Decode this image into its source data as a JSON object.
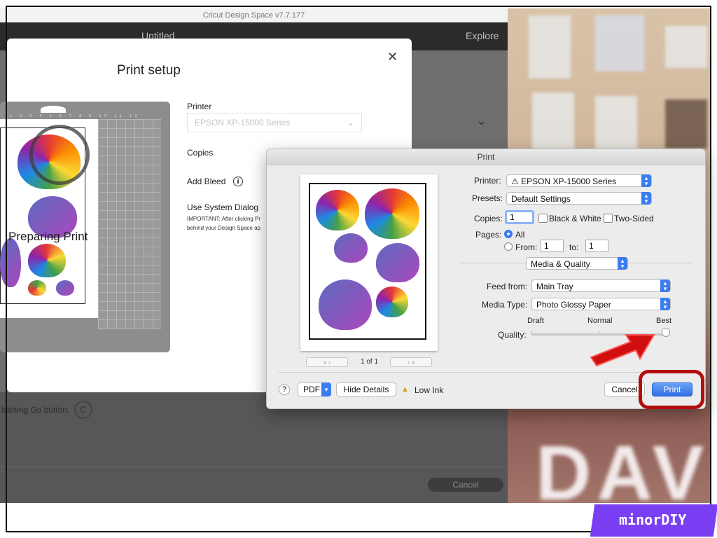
{
  "app": {
    "title": "Cricut Design Space  v7.7.177",
    "project_name": "Untitled",
    "explore": "Explore"
  },
  "print_setup": {
    "title": "Print setup",
    "close_glyph": "✕",
    "printer_label": "Printer",
    "printer_value": "EPSON XP-15000 Series",
    "copies_label": "Copies",
    "add_bleed_label": "Add Bleed",
    "info_glyph": "i",
    "system_dialog_label": "Use System Dialog",
    "important_line1": "IMPORTANT: After clicking Pr",
    "important_line2": "behind your Design Space ap",
    "preparing_text": "Preparing Print",
    "go_hint": "lashing Go button.",
    "cancel_label": "Cancel",
    "mat_ruler_top": [
      "1",
      "2",
      "3",
      "4",
      "5",
      "6",
      "7",
      "8",
      "9",
      "10",
      "11",
      "12"
    ]
  },
  "print_dialog": {
    "title": "Print",
    "printer_label": "Printer:",
    "printer_value": "⚠ EPSON XP-15000 Series",
    "presets_label": "Presets:",
    "presets_value": "Default Settings",
    "copies_label": "Copies:",
    "copies_value": "1",
    "bw_label": "Black & White",
    "two_sided_label": "Two-Sided",
    "pages_label": "Pages:",
    "all_label": "All",
    "from_label": "From:",
    "from_value": "1",
    "to_label": "to:",
    "to_value": "1",
    "section_value": "Media & Quality",
    "feed_label": "Feed from:",
    "feed_value": "Main Tray",
    "media_label": "Media Type:",
    "media_value": "Photo Glossy Paper",
    "quality_label": "Quality:",
    "quality_draft": "Draft",
    "quality_normal": "Normal",
    "quality_best": "Best",
    "quality_level": 1.0,
    "page_indicator": "1 of 1",
    "help_glyph": "?",
    "pdf_label": "PDF",
    "hide_details_label": "Hide Details",
    "low_ink_label": "Low Ink",
    "cancel_label": "Cancel",
    "print_label": "Print"
  },
  "watermark": "minorDIY",
  "colors": {
    "accent_blue": "#3b7cf0",
    "annotation_red": "#d10f0f",
    "watermark_purple": "#7a3ff2"
  }
}
